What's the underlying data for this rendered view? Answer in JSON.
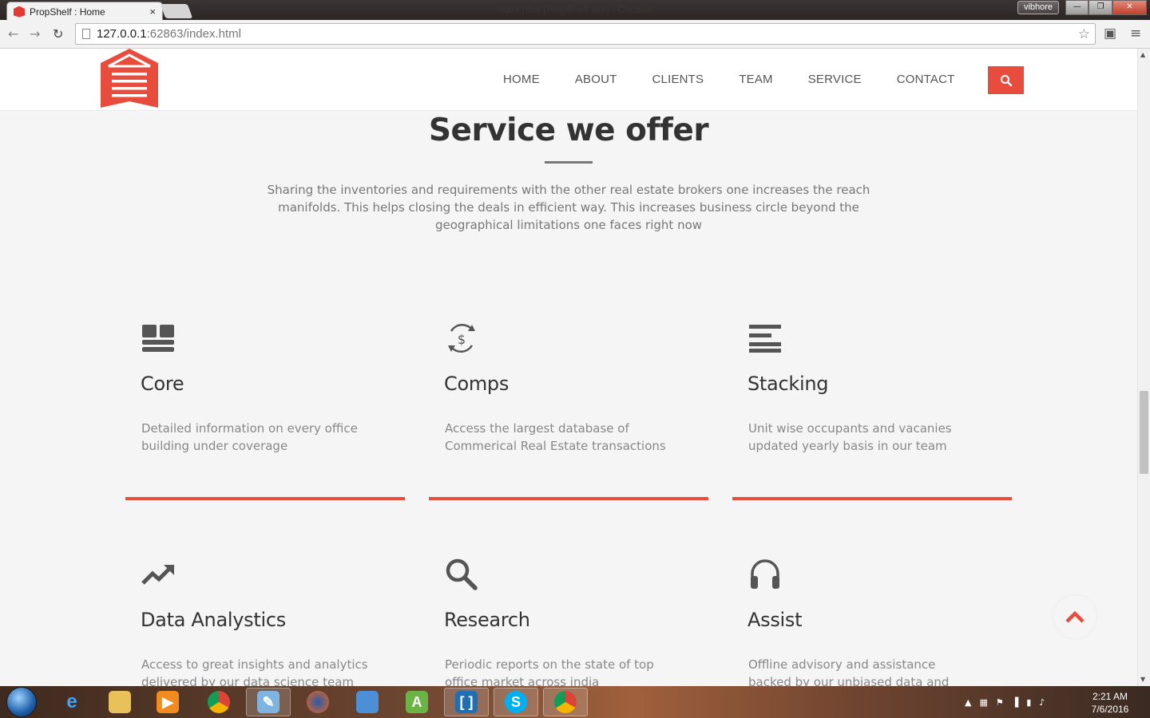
{
  "browser": {
    "tab_title": "PropShelf : Home",
    "tab_close": "×",
    "window_title": "index.html (PropShelf site) - Chrome",
    "user": "vibhore",
    "url_host": "127.0.0.1",
    "url_rest": ":62863/index.html",
    "controls": {
      "minimize": "—",
      "restore": "❐",
      "close": "✕"
    }
  },
  "header": {
    "logo_icon": "house-stack-logo-icon",
    "nav": [
      "HOME",
      "ABOUT",
      "CLIENTS",
      "TEAM",
      "SERVICE",
      "CONTACT"
    ],
    "search_icon": "search-icon",
    "accent_color": "#e74c3c"
  },
  "service": {
    "title": "Service we offer",
    "description": "Sharing the inventories and requirements with the other real estate brokers one increases the reach manifolds. This helps closing the deals in efficient way. This increases business circle beyond the geographical limitations one faces right now",
    "cards": [
      {
        "icon": "dashboard-icon",
        "title": "Core",
        "text": "Detailed information on every office building under coverage"
      },
      {
        "icon": "dollar-cycle-icon",
        "title": "Comps",
        "text": "Access the largest database of Commerical Real Estate transactions"
      },
      {
        "icon": "stacking-bars-icon",
        "title": "Stacking",
        "text": "Unit wise occupants and vacanies updated yearly basis in our team"
      },
      {
        "icon": "trending-up-icon",
        "title": "Data Analystics",
        "text": "Access to great insights and analytics delivered by our data science team"
      },
      {
        "icon": "magnifier-icon",
        "title": "Research",
        "text": "Periodic reports on the state of top office market across india"
      },
      {
        "icon": "headset-icon",
        "title": "Assist",
        "text": "Offline advisory and assistance backed by our unbiased data and research"
      }
    ]
  },
  "back_to_top_icon": "chevron-up-icon",
  "taskbar": {
    "apps": [
      "ie-icon",
      "file-explorer-icon",
      "media-player-icon",
      "chrome-icon",
      "paint-icon",
      "firefox-icon",
      "control-panel-icon",
      "android-studio-icon",
      "brackets-icon",
      "skype-icon",
      "chrome-canary-icon"
    ],
    "time": "2:21 AM",
    "date": "7/6/2016"
  }
}
